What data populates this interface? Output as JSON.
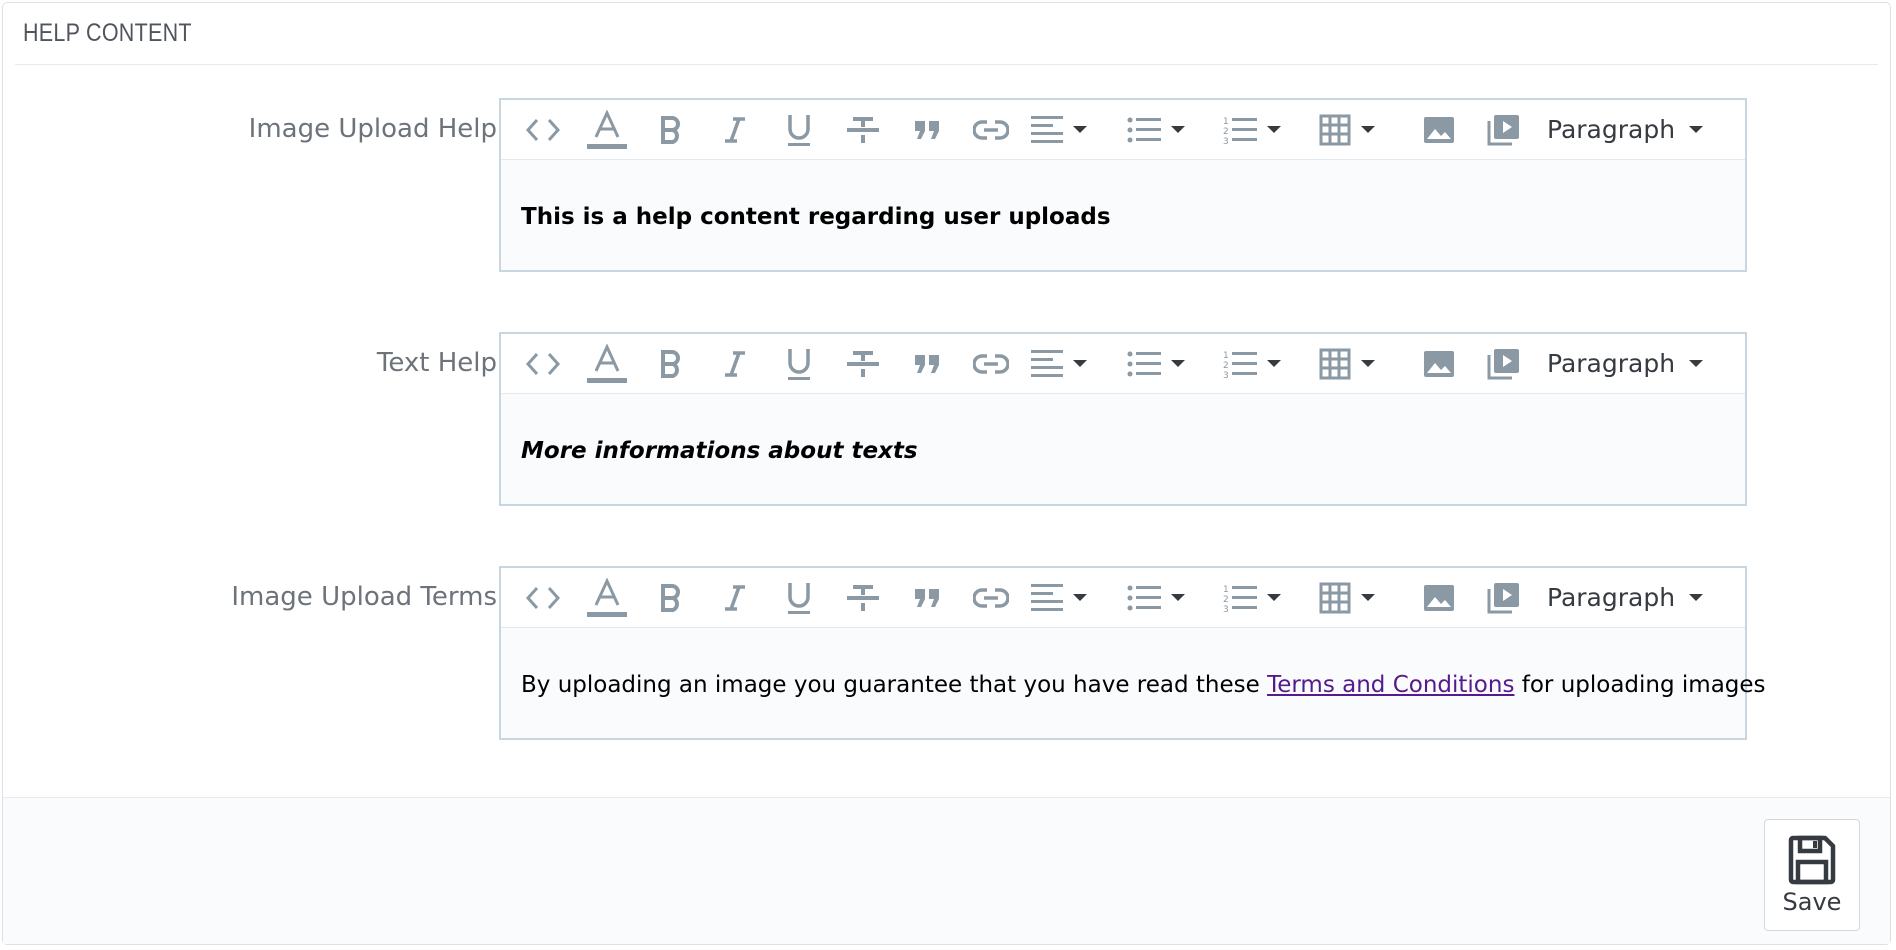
{
  "panel": {
    "title": "HELP CONTENT"
  },
  "toolbar": {
    "icons": [
      "code-icon",
      "text-color-icon",
      "bold-icon",
      "italic-icon",
      "underline-icon",
      "strikethrough-icon",
      "blockquote-icon",
      "link-icon",
      "align-icon",
      "bullet-list-icon",
      "numbered-list-icon",
      "table-icon",
      "image-icon",
      "media-icon"
    ],
    "format_label": "Paragraph"
  },
  "fields": [
    {
      "label": "Image Upload Help",
      "content": "This is a help content regarding user uploads"
    },
    {
      "label": "Text Help",
      "content": "More informations about texts"
    },
    {
      "label": "Image Upload Terms",
      "content_before": "By uploading an image you guarantee that you have read these ",
      "link_text": "Terms and Conditions",
      "content_after": " for uploading images"
    }
  ],
  "footer": {
    "save_label": "Save"
  },
  "colors": {
    "icon": "#8a99a4",
    "border": "#c8d6df",
    "link": "#551a8b",
    "footer_bg": "#fafbfc"
  }
}
